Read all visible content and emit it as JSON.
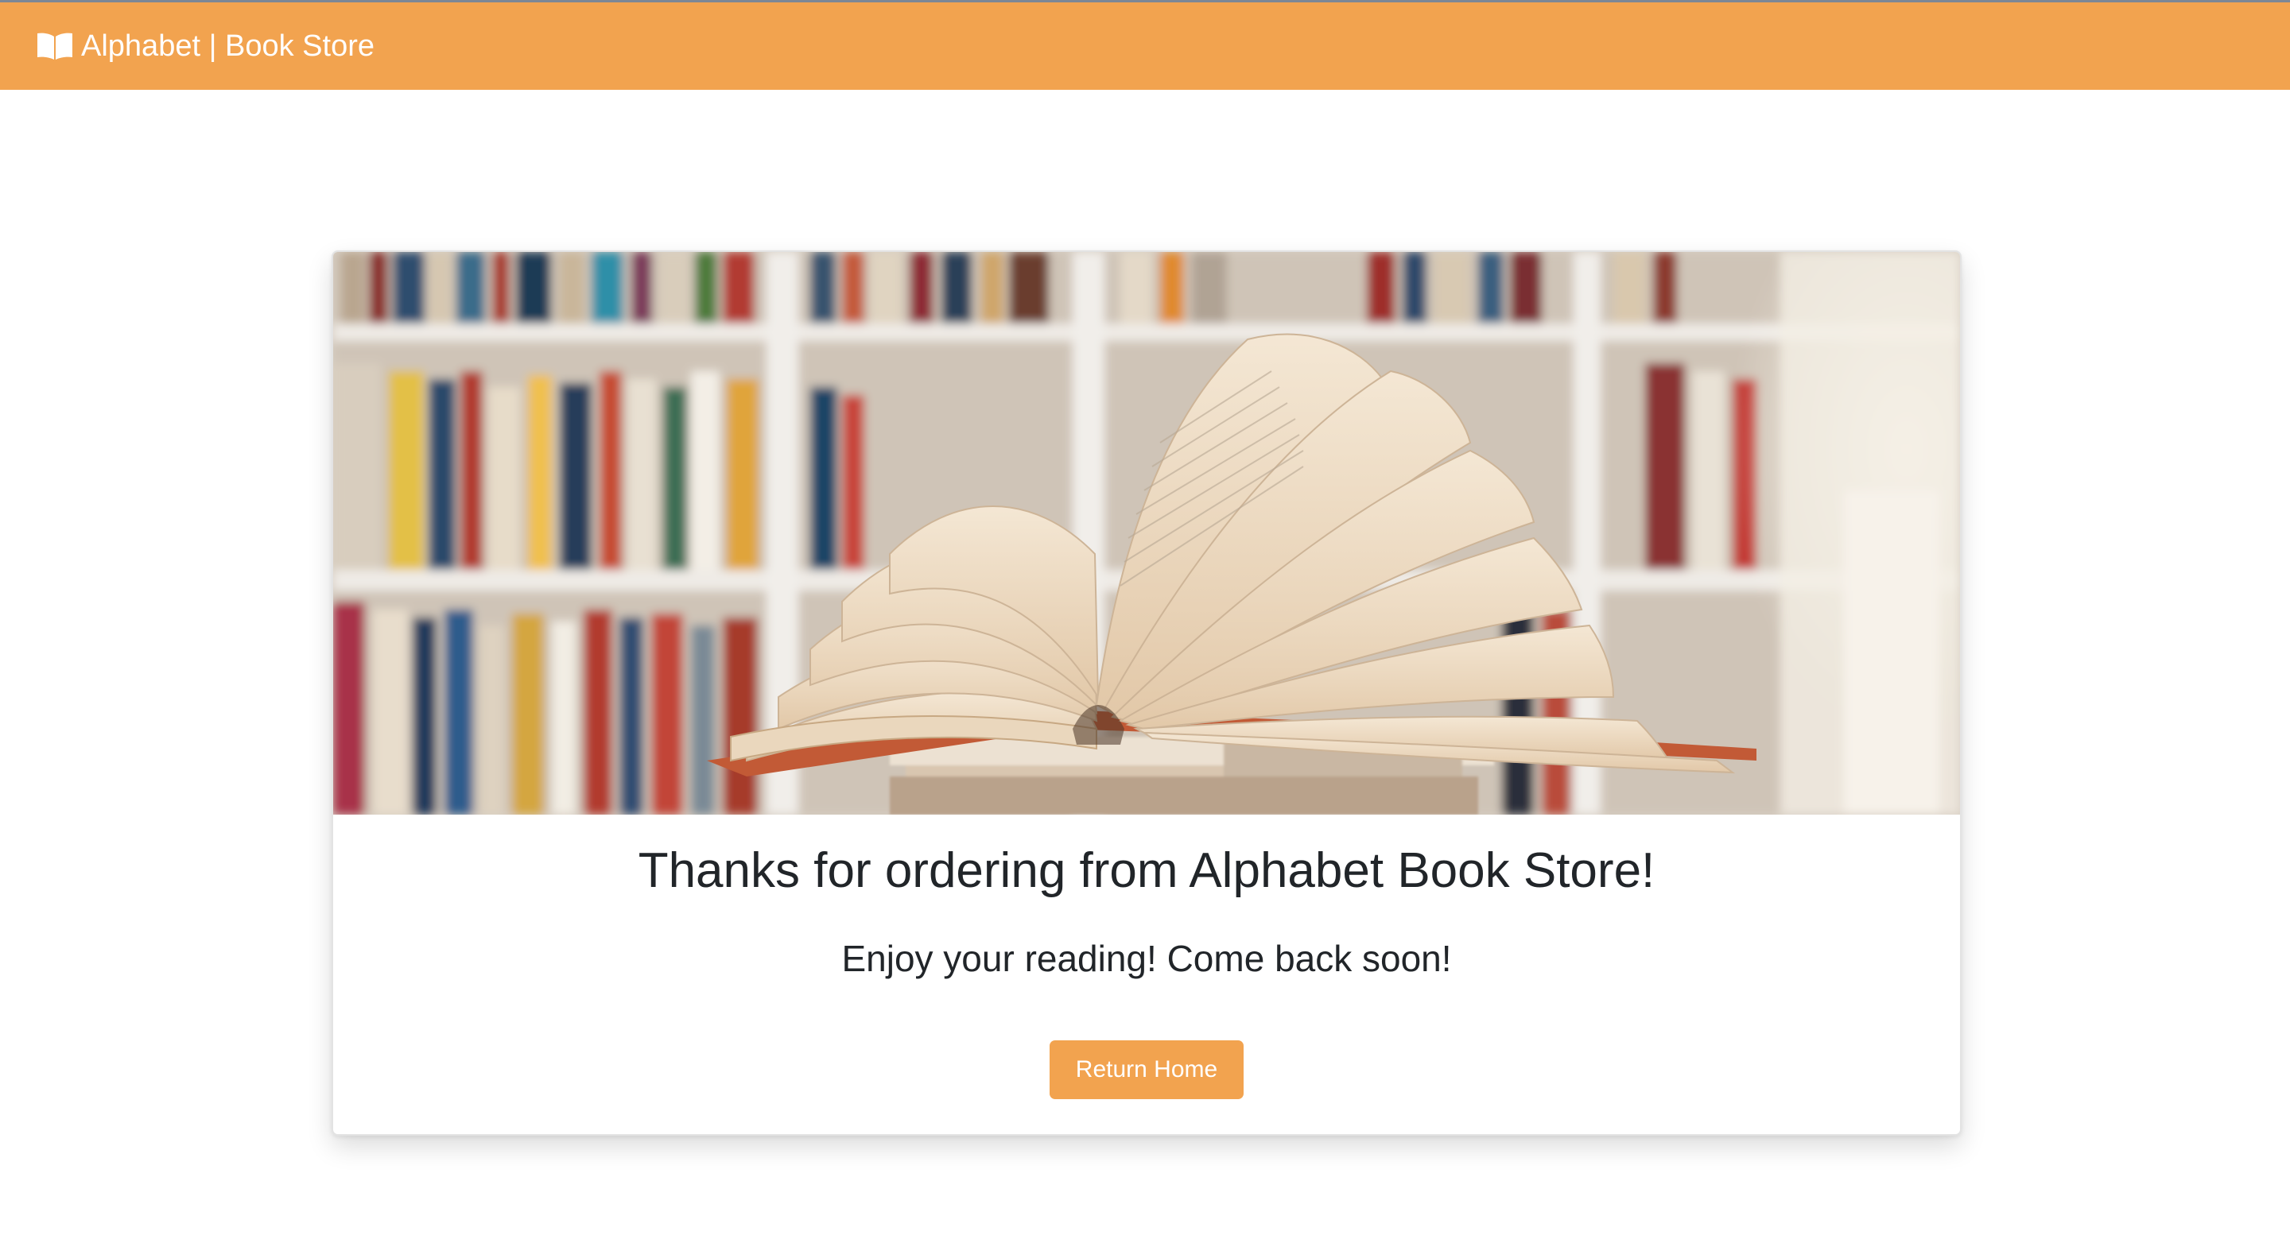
{
  "navbar": {
    "brand_label": "Alphabet | Book Store",
    "brand_icon": "open-book-icon",
    "background_color": "#f2a34f"
  },
  "card": {
    "image_description_icon": "bookshelf-open-book-photo",
    "title": "Thanks for ordering from Alphabet Book Store!",
    "subtitle": "Enjoy your reading! Come back soon!",
    "button_label": "Return Home",
    "button_color": "#f2a34f"
  }
}
